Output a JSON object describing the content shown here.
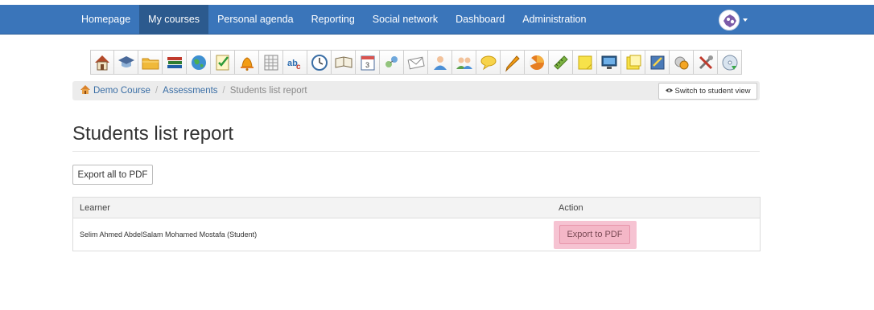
{
  "nav": {
    "items": [
      {
        "label": "Homepage",
        "active": false
      },
      {
        "label": "My courses",
        "active": true
      },
      {
        "label": "Personal agenda",
        "active": false
      },
      {
        "label": "Reporting",
        "active": false
      },
      {
        "label": "Social network",
        "active": false
      },
      {
        "label": "Dashboard",
        "active": false
      },
      {
        "label": "Administration",
        "active": false
      }
    ],
    "bar_color": "#3a75ba",
    "active_color": "#2c5a8e"
  },
  "tools": [
    "home-icon",
    "graduation-cap-icon",
    "folder-icon",
    "books-icon",
    "globe-icon",
    "checklist-icon",
    "bell-icon",
    "spreadsheet-icon",
    "spelling-icon",
    "clock-icon",
    "open-book-icon",
    "calendar-icon",
    "users-link-icon",
    "envelope-icon",
    "user-icon",
    "group-icon",
    "chat-bubble-icon",
    "pencil-icon",
    "pie-chart-icon",
    "pencil-ruler-icon",
    "sticky-note-icon",
    "monitor-icon",
    "notes-icon",
    "survey-icon",
    "gallery-icon",
    "settings-tools-icon",
    "recycle-disc-icon"
  ],
  "breadcrumb": {
    "items": [
      "Demo Course",
      "Assessments"
    ],
    "current": "Students list report"
  },
  "switch_view": {
    "label": "Switch to student view"
  },
  "page": {
    "title": "Students list report",
    "export_all_label": "Export all to PDF"
  },
  "table": {
    "headers": [
      "Learner",
      "Action"
    ],
    "rows": [
      {
        "learner": "Selim Ahmed AbdelSalam Mohamed Mostafa (Student)",
        "action": "Export to PDF"
      }
    ]
  },
  "colors": {
    "link": "#3a6ea5",
    "highlight": "#f6c3d2"
  }
}
